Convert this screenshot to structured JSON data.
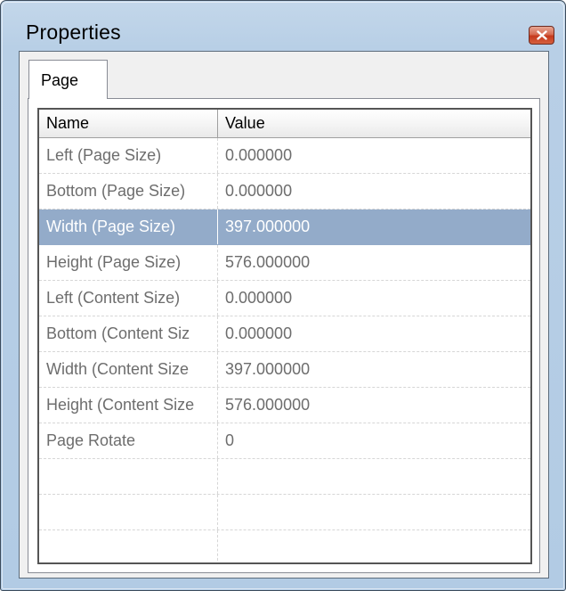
{
  "window": {
    "title": "Properties",
    "close_icon": "close-icon"
  },
  "tabs": [
    {
      "label": "Page",
      "selected": true
    }
  ],
  "grid": {
    "columns": [
      "Name",
      "Value"
    ],
    "rows": [
      {
        "name": "Left (Page Size)",
        "value": "0.000000",
        "selected": false
      },
      {
        "name": "Bottom (Page Size)",
        "value": "0.000000",
        "selected": false
      },
      {
        "name": "Width (Page Size)",
        "value": "397.000000",
        "selected": true
      },
      {
        "name": "Height (Page Size)",
        "value": "576.000000",
        "selected": false
      },
      {
        "name": "Left (Content Size)",
        "value": "0.000000",
        "selected": false
      },
      {
        "name": "Bottom (Content Siz",
        "value": "0.000000",
        "selected": false
      },
      {
        "name": "Width (Content Size",
        "value": "397.000000",
        "selected": false
      },
      {
        "name": "Height (Content Size",
        "value": "576.000000",
        "selected": false
      },
      {
        "name": "Page Rotate",
        "value": "0",
        "selected": false
      },
      {
        "name": "",
        "value": "",
        "selected": false
      },
      {
        "name": "",
        "value": "",
        "selected": false
      },
      {
        "name": "",
        "value": "",
        "selected": false
      }
    ]
  },
  "colors": {
    "selection": "#93abc9",
    "close_button": "#c5381b",
    "window_frame": "#b8cfe6"
  }
}
